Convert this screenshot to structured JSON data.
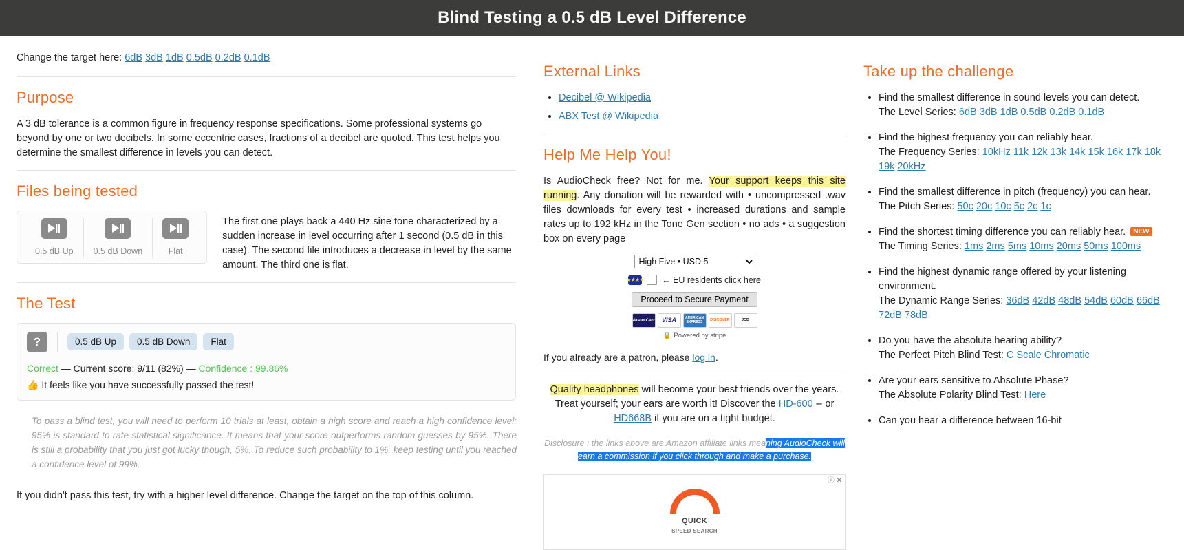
{
  "header": {
    "title": "Blind Testing a 0.5 dB Level Difference"
  },
  "target": {
    "label": "Change the target here:",
    "options": [
      "6dB",
      "3dB",
      "1dB",
      "0.5dB",
      "0.2dB",
      "0.1dB"
    ]
  },
  "purpose": {
    "heading": "Purpose",
    "body": "A 3 dB tolerance is a common figure in frequency response specifications. Some professional systems go beyond by one or two decibels. In some eccentric cases, fractions of a decibel are quoted. This test helps you determine the smallest difference in levels you can detect."
  },
  "files": {
    "heading": "Files being tested",
    "players": [
      {
        "label": "0.5 dB Up",
        "icon": "play-pause-icon"
      },
      {
        "label": "0.5 dB Down",
        "icon": "play-pause-icon"
      },
      {
        "label": "Flat",
        "icon": "play-pause-icon"
      }
    ],
    "description": "The first one plays back a 440 Hz sine tone characterized by a sudden increase in level occurring after 1 second (0.5 dB in this case). The second file introduces a decrease in level by the same amount. The third one is flat."
  },
  "test": {
    "heading": "The Test",
    "unknown_button": "?",
    "answers": [
      "0.5 dB Up",
      "0.5 dB Down",
      "Flat"
    ],
    "result_status": "Correct",
    "result_middle": " — Current score: 9/11 (82%) — ",
    "confidence": "Confidence : 99.86%",
    "passed_icon": "thumbs-up-icon",
    "passed_text": "It feels like you have successfully passed the test!",
    "note": "To pass a blind test, you will need to perform 10 trials at least, obtain a high score and reach a high confidence level: 95% is standard to rate statistical significance. It means that your score outperforms random guesses by 95%. There is still a probability that you just got lucky though, 5%. To reduce such probability to 1%, keep testing until you reached a confidence level of 99%.",
    "footer": "If you didn't pass this test, try with a higher level difference. Change the target on the top of this column."
  },
  "external_links": {
    "heading": "External Links",
    "items": [
      "Decibel @ Wikipedia",
      "ABX Test @ Wikipedia"
    ]
  },
  "help": {
    "heading": "Help Me Help You!",
    "para_pre": "Is AudioCheck free? Not for me. ",
    "para_highlight": "Your support keeps this site running",
    "para_post": ". Any donation will be rewarded with • uncompressed .wav files downloads for every test • increased durations and sample rates up to 192 kHz in the Tone Gen section • no ads • a suggestion box on every page",
    "amount_selected": "High Five • USD 5",
    "amount_options": [
      "High Five • USD 5"
    ],
    "eu_note": "← EU residents click here",
    "proceed_label": "Proceed to Secure Payment",
    "cards": [
      "MasterCard",
      "VISA",
      "AMERICAN EXPRESS",
      "DISCOVER",
      "JCB"
    ],
    "stripe_text": "Powered by stripe",
    "patron_pre": "If you already are a patron, please ",
    "patron_link": "log in",
    "patron_post": ".",
    "headphones_highlight": "Quality headphones",
    "headphones_pre": " will become your best friends over the years. Treat yourself; your ears are worth it! Discover the ",
    "headphones_link1": "HD-600",
    "headphones_mid": " -- or ",
    "headphones_link2": "HD668B",
    "headphones_post": " if you are on a tight budget.",
    "disclosure_plain": "Disclosure : the links above are Amazon affiliate links mea",
    "disclosure_selected": "ning AudioCheck will earn a commission if you click through and make a purchase.",
    "ad_label": "ⓘ ✕",
    "ad_brand": "QUICK",
    "ad_sub": "SPEED SEARCH"
  },
  "challenge": {
    "heading": "Take up the challenge",
    "items": [
      {
        "text": "Find the smallest difference in sound levels you can detect.",
        "series_label": "The Level Series:",
        "links": [
          "6dB",
          "3dB",
          "1dB",
          "0.5dB",
          "0.2dB",
          "0.1dB"
        ],
        "badge": ""
      },
      {
        "text": "Find the highest frequency you can reliably hear.",
        "series_label": "The Frequency Series:",
        "links": [
          "10kHz",
          "11k",
          "12k",
          "13k",
          "14k",
          "15k",
          "16k",
          "17k",
          "18k",
          "19k",
          "20kHz"
        ],
        "badge": ""
      },
      {
        "text": "Find the smallest difference in pitch (frequency) you can hear.",
        "series_label": "The Pitch Series:",
        "links": [
          "50c",
          "20c",
          "10c",
          "5c",
          "2c",
          "1c"
        ],
        "badge": ""
      },
      {
        "text": "Find the shortest timing difference you can reliably hear.",
        "series_label": "The Timing Series:",
        "links": [
          "1ms",
          "2ms",
          "5ms",
          "10ms",
          "20ms",
          "50ms",
          "100ms"
        ],
        "badge": "NEW"
      },
      {
        "text": "Find the highest dynamic range offered by your listening environment.",
        "series_label": "The Dynamic Range Series:",
        "links": [
          "36dB",
          "42dB",
          "48dB",
          "54dB",
          "60dB",
          "66dB",
          "72dB",
          "78dB"
        ],
        "badge": ""
      },
      {
        "text": "Do you have the absolute hearing ability?",
        "series_label": "The Perfect Pitch Blind Test:",
        "links": [
          "C Scale",
          "Chromatic"
        ],
        "badge": ""
      },
      {
        "text": "Are your ears sensitive to Absolute Phase?",
        "series_label": "The Absolute Polarity Blind Test:",
        "links": [
          "Here"
        ],
        "badge": ""
      },
      {
        "text": "Can you hear a difference between 16-bit",
        "series_label": "",
        "links": [],
        "badge": ""
      }
    ]
  },
  "colors": {
    "header_bg": "#3c3c3b",
    "accent_orange": "#f26c21",
    "link_blue": "#2d7cb0",
    "success_green": "#4fc94f",
    "selection_blue": "#1878f0",
    "highlight_yellow": "#fbf39a",
    "button_gray": "#8a8a8a",
    "answer_blue": "#d5e3f0"
  }
}
